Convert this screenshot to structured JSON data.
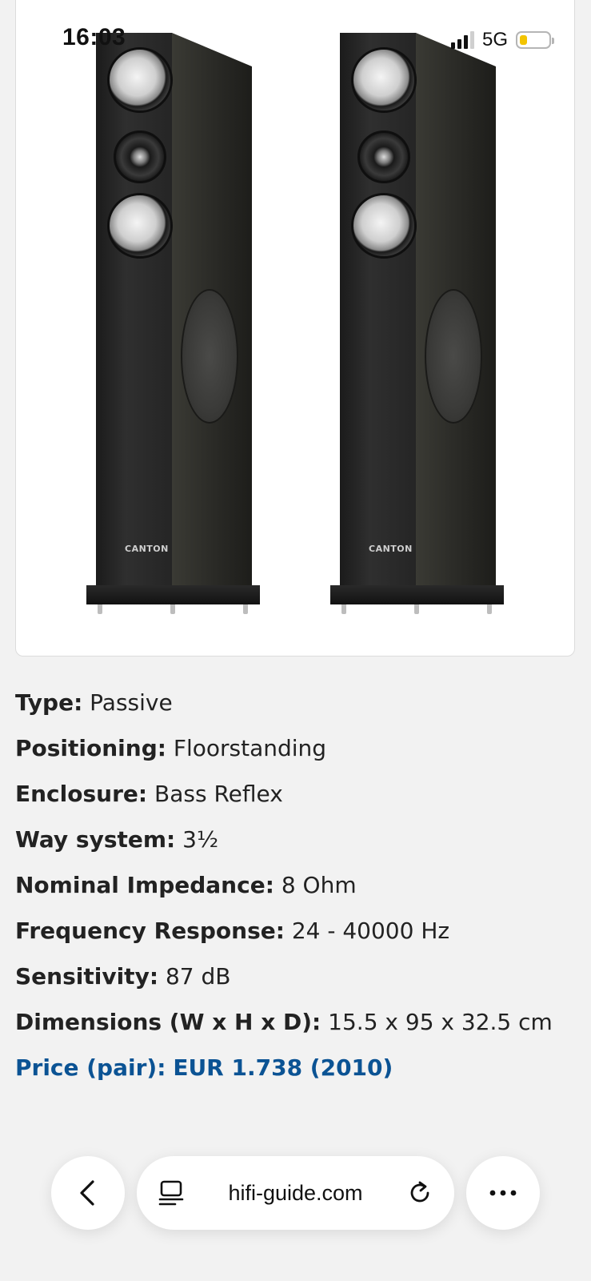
{
  "status_bar": {
    "time": "16:03",
    "network": "5G"
  },
  "product_image": {
    "brand_mark": "CANTON"
  },
  "specs": [
    {
      "label": "Type:",
      "value": "Passive"
    },
    {
      "label": "Positioning:",
      "value": "Floorstanding"
    },
    {
      "label": "Enclosure:",
      "value": "Bass Reflex"
    },
    {
      "label": "Way system:",
      "value": "3½"
    },
    {
      "label": "Nominal Impedance:",
      "value": "8 Ohm"
    },
    {
      "label": "Frequency Response:",
      "value": "24 - 40000 Hz"
    },
    {
      "label": "Sensitivity:",
      "value": "87 dB"
    },
    {
      "label": "Dimensions (W x H x D):",
      "value": "15.5 x 95 x 32.5 cm"
    }
  ],
  "price": {
    "label": "Price (pair):",
    "value": "EUR 1.738 (2010)"
  },
  "browser": {
    "url": "hifi-guide.com"
  },
  "colors": {
    "accent": "#0b5394",
    "background": "#f2f2f2",
    "battery": "#f3c400"
  }
}
